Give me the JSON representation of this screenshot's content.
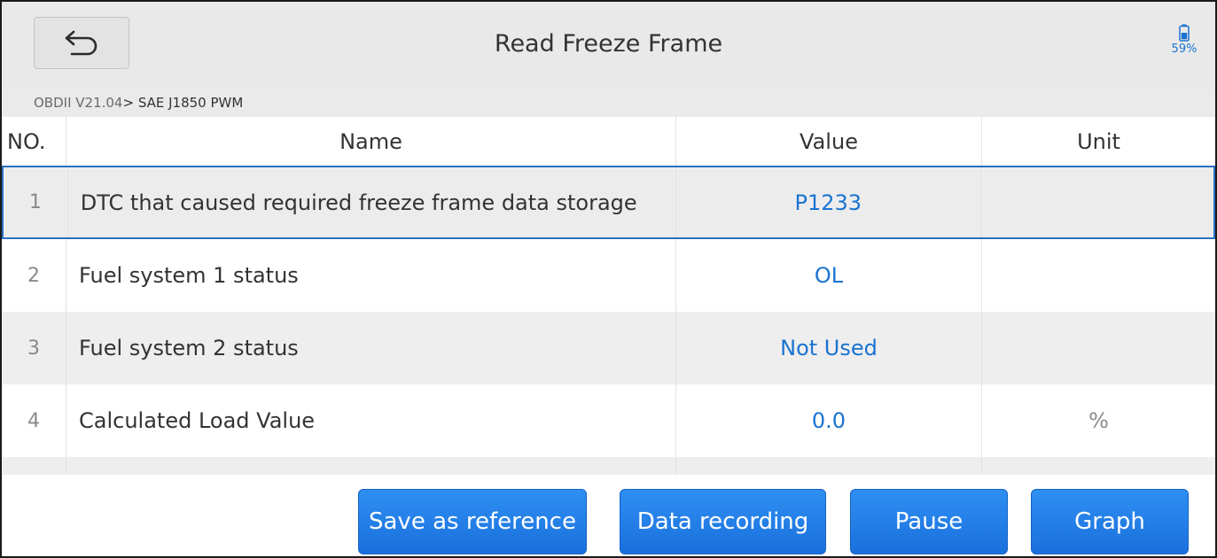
{
  "header": {
    "title": "Read Freeze Frame",
    "battery_percent": "59%"
  },
  "breadcrumb": {
    "path": "OBDII V21.04",
    "separator": ">",
    "current": " SAE J1850 PWM"
  },
  "table": {
    "columns": [
      "NO.",
      "Name",
      "Value",
      "Unit"
    ],
    "rows": [
      {
        "no": "1",
        "name": "DTC that caused required freeze frame data storage",
        "value": "P1233",
        "unit": ""
      },
      {
        "no": "2",
        "name": "Fuel system 1 status",
        "value": "OL",
        "unit": ""
      },
      {
        "no": "3",
        "name": "Fuel system 2 status",
        "value": "Not Used",
        "unit": ""
      },
      {
        "no": "4",
        "name": "Calculated Load Value",
        "value": "0.0",
        "unit": "%"
      }
    ],
    "selected_row": "1"
  },
  "toolbar": {
    "save_reference_label": "Save as reference",
    "data_recording_label": "Data recording",
    "pause_label": "Pause",
    "graph_label": "Graph"
  },
  "colors": {
    "accent": "#1a73d0",
    "button": "#2680e8",
    "titlebar": "#e9e9ea",
    "alt_row": "#eeeeef"
  },
  "icons": {
    "back": "back-arrow-icon",
    "battery": "battery-icon"
  }
}
